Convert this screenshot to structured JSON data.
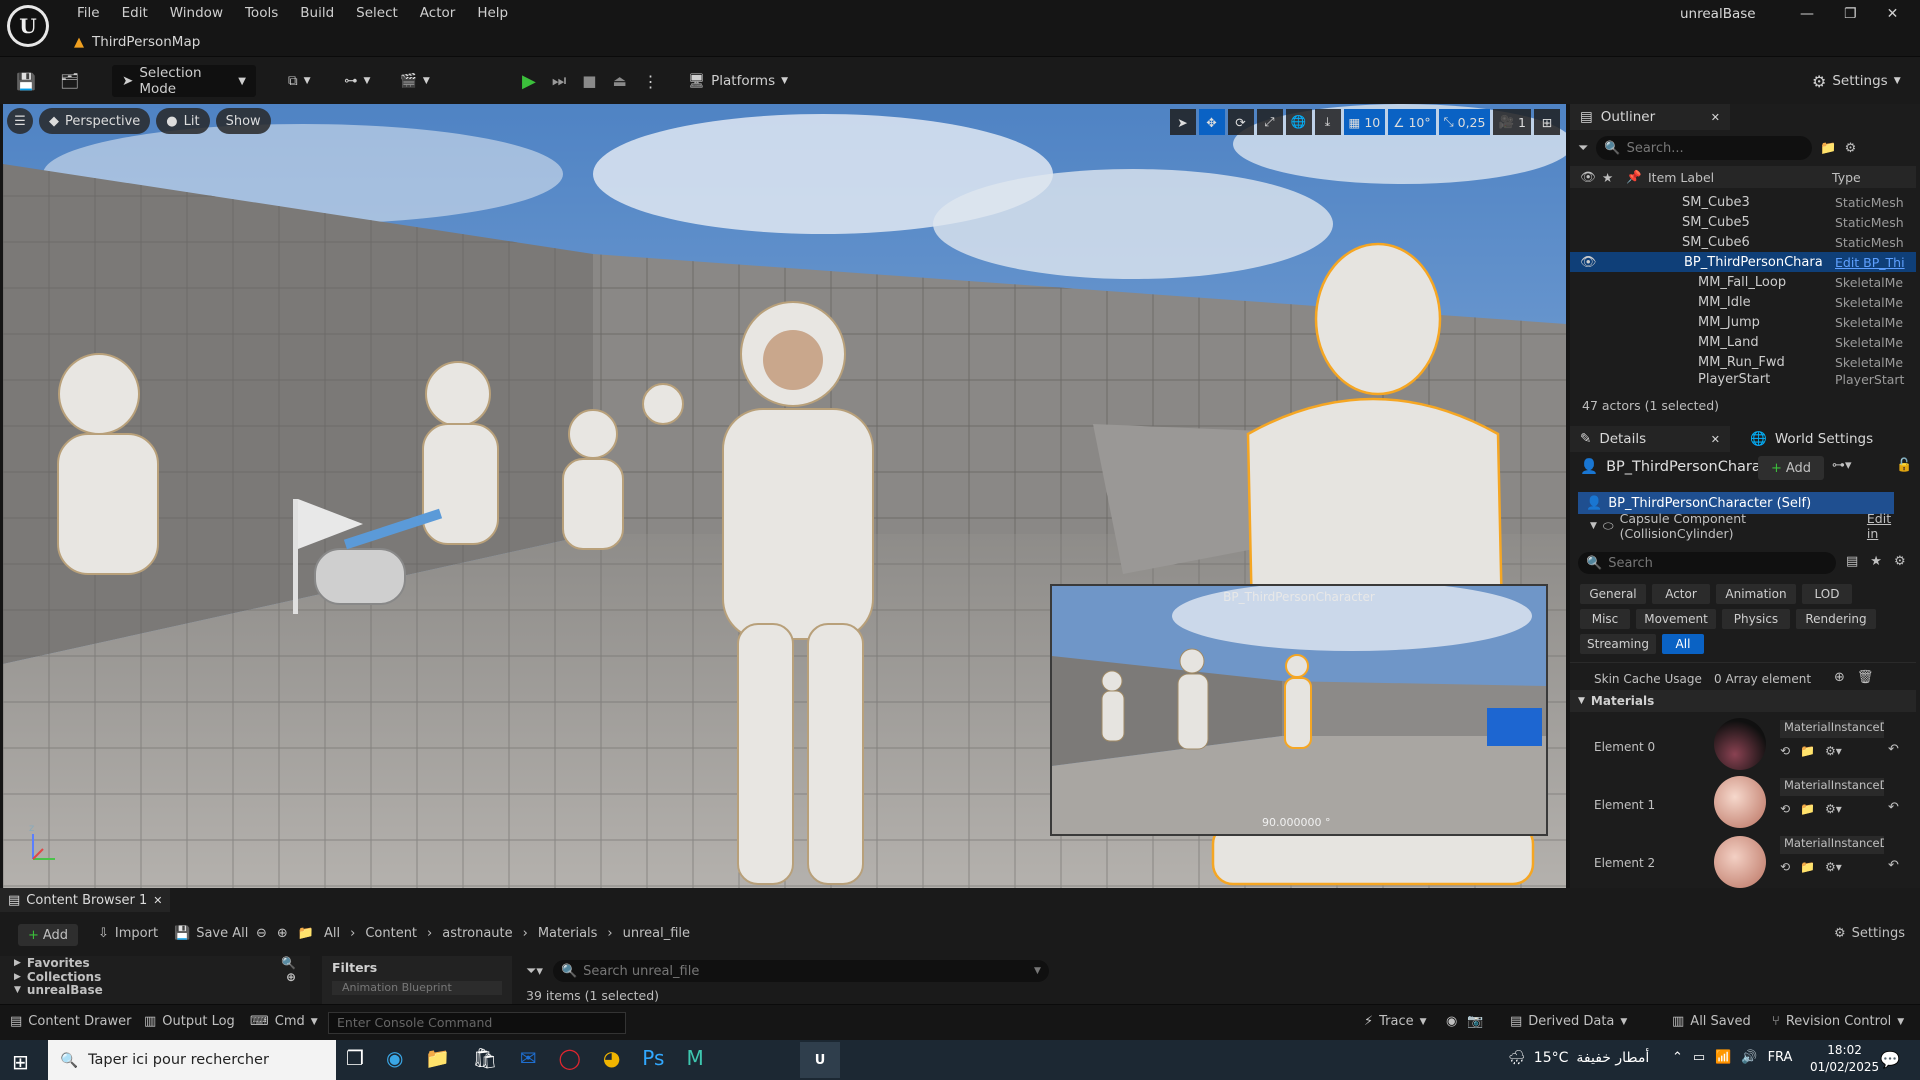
{
  "app": {
    "window_title": "unrealBase",
    "doc_tab": "ThirdPersonMap"
  },
  "menu": [
    "File",
    "Edit",
    "Window",
    "Tools",
    "Build",
    "Select",
    "Actor",
    "Help"
  ],
  "toolbar": {
    "selection_mode": "Selection Mode",
    "platforms": "Platforms",
    "settings": "Settings"
  },
  "viewport": {
    "perspective": "Perspective",
    "lit": "Lit",
    "show": "Show",
    "grid_snap": "10",
    "rotation_snap": "10°",
    "scale_snap": "0,25",
    "camera_speed": "1",
    "preview_title": "BP_ThirdPersonCharacter",
    "preview_fov": "90.000000 °"
  },
  "outliner": {
    "tab": "Outliner",
    "search_placeholder": "Search...",
    "col_label": "Item Label",
    "col_type": "Type",
    "rows": [
      {
        "label": "SM_Cube3",
        "type": "StaticMesh"
      },
      {
        "label": "SM_Cube5",
        "type": "StaticMesh"
      },
      {
        "label": "SM_Cube6",
        "type": "StaticMesh"
      },
      {
        "label": "BP_ThirdPersonChara",
        "type": "Edit BP_Thi"
      },
      {
        "label": "MM_Fall_Loop",
        "type": "SkeletalMe"
      },
      {
        "label": "MM_Idle",
        "type": "SkeletalMe"
      },
      {
        "label": "MM_Jump",
        "type": "SkeletalMe"
      },
      {
        "label": "MM_Land",
        "type": "SkeletalMe"
      },
      {
        "label": "MM_Run_Fwd",
        "type": "SkeletalMe"
      },
      {
        "label": "PlayerStart",
        "type": "PlayerStart"
      }
    ],
    "footer": "47 actors (1 selected)"
  },
  "details": {
    "tab": "Details",
    "world_tab": "World Settings",
    "actor_name": "BP_ThirdPersonChara",
    "add": "Add",
    "self_row": "BP_ThirdPersonCharacter (Self)",
    "capsule_row": "Capsule Component (CollisionCylinder)",
    "edit_in": "Edit in",
    "search_placeholder": "Search",
    "filters": [
      "General",
      "Actor",
      "Animation",
      "LOD",
      "Misc",
      "Movement",
      "Physics",
      "Rendering",
      "Streaming",
      "All"
    ],
    "skin_cache_label": "Skin Cache Usage",
    "skin_cache_value": "0 Array element",
    "materials_header": "Materials",
    "elements": [
      {
        "label": "Element 0",
        "value": "MaterialInstanceD"
      },
      {
        "label": "Element 1",
        "value": "MaterialInstanceD"
      },
      {
        "label": "Element 2",
        "value": "MaterialInstanceD"
      }
    ]
  },
  "content_browser": {
    "tab": "Content Browser 1",
    "add": "Add",
    "import": "Import",
    "save_all": "Save All",
    "path": [
      "All",
      "Content",
      "astronaute",
      "Materials",
      "unreal_file"
    ],
    "settings": "Settings",
    "favorites": "Favorites",
    "collections": "Collections",
    "unrealbase": "unrealBase",
    "filters": "Filters",
    "filter_item": "Animation Blueprint",
    "search_placeholder": "Search unreal_file",
    "items": "39 items (1 selected)"
  },
  "statusbar": {
    "content_drawer": "Content Drawer",
    "output_log": "Output Log",
    "cmd": "Cmd",
    "console_placeholder": "Enter Console Command",
    "trace": "Trace",
    "derived_data": "Derived Data",
    "all_saved": "All Saved",
    "revision_control": "Revision Control"
  },
  "taskbar": {
    "search_placeholder": "Taper ici pour rechercher",
    "temperature": "15°C",
    "weather": "أمطار خفيفة",
    "lang": "FRA",
    "time": "18:02",
    "date": "01/02/2025"
  },
  "colors": {
    "accent": "#0a62c4",
    "selection_orange": "#f5a623",
    "play_green": "#3bbf3b"
  }
}
